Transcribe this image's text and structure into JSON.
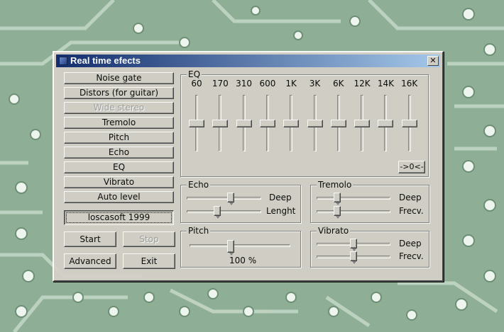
{
  "window": {
    "title": "Real time efects"
  },
  "effects": [
    {
      "label": "Noise gate",
      "enabled": true
    },
    {
      "label": "Distors (for guitar)",
      "enabled": true
    },
    {
      "label": "Wide stereo",
      "enabled": false
    },
    {
      "label": "Tremolo",
      "enabled": true
    },
    {
      "label": "Pitch",
      "enabled": true
    },
    {
      "label": "Echo",
      "enabled": true
    },
    {
      "label": "EQ",
      "enabled": true
    },
    {
      "label": "Vibrato",
      "enabled": true
    },
    {
      "label": "Auto level",
      "enabled": true
    }
  ],
  "credit": "loscasoft 1999",
  "buttons": {
    "start": "Start",
    "stop": "Stop",
    "advanced": "Advanced",
    "exit": "Exit"
  },
  "eq": {
    "title": "EQ",
    "bands": [
      {
        "label": "60",
        "level": 0.5
      },
      {
        "label": "170",
        "level": 0.5
      },
      {
        "label": "310",
        "level": 0.5
      },
      {
        "label": "600",
        "level": 0.5
      },
      {
        "label": "1K",
        "level": 0.5
      },
      {
        "label": "3K",
        "level": 0.5
      },
      {
        "label": "6K",
        "level": 0.5
      },
      {
        "label": "12K",
        "level": 0.5
      },
      {
        "label": "14K",
        "level": 0.5
      },
      {
        "label": "16K",
        "level": 0.5
      }
    ],
    "reset_label": "->0<-"
  },
  "echo": {
    "title": "Echo",
    "deep_label": "Deep",
    "deep": 0.6,
    "length_label": "Lenght",
    "length": 0.4
  },
  "tremolo": {
    "title": "Tremolo",
    "deep_label": "Deep",
    "deep": 0.25,
    "freq_label": "Frecv.",
    "freq": 0.25
  },
  "pitch": {
    "title": "Pitch",
    "value": 0.4,
    "value_label": "100 %"
  },
  "vibrato": {
    "title": "Vibrato",
    "deep_label": "Deep",
    "deep": 0.5,
    "freq_label": "Frecv.",
    "freq": 0.5
  },
  "colors": {
    "titlebar_start": "#0a246a",
    "titlebar_end": "#a6caf0",
    "face": "#d4d0c8",
    "board": "#8fae96"
  }
}
